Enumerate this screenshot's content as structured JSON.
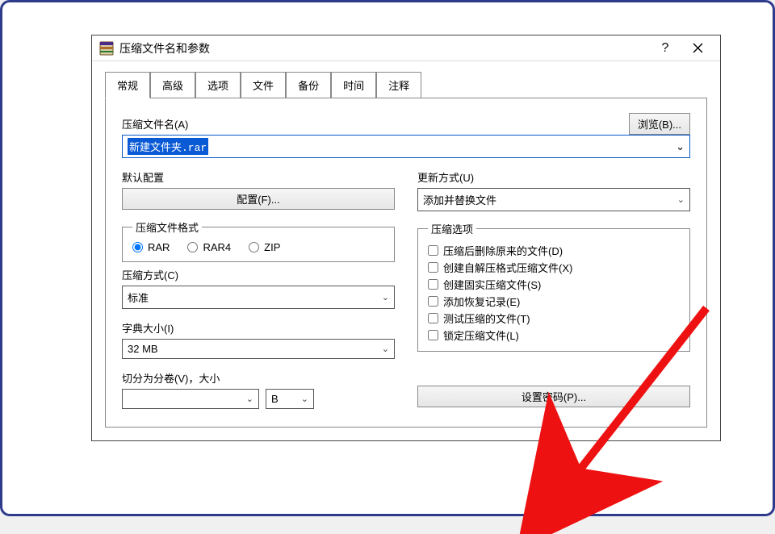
{
  "window": {
    "title": "压缩文件名和参数",
    "help": "?",
    "close": "X"
  },
  "tabs": {
    "items": [
      {
        "key": "general",
        "label": "常规"
      },
      {
        "key": "advanced",
        "label": "高级"
      },
      {
        "key": "options",
        "label": "选项"
      },
      {
        "key": "files",
        "label": "文件"
      },
      {
        "key": "backup",
        "label": "备份"
      },
      {
        "key": "time",
        "label": "时间"
      },
      {
        "key": "comment",
        "label": "注释"
      }
    ],
    "active": "general"
  },
  "general": {
    "archive_name_label": "压缩文件名(A)",
    "browse_label": "浏览(B)...",
    "archive_name_value": "新建文件夹.rar",
    "default_profile_label": "默认配置",
    "profiles_button": "配置(F)...",
    "update_mode_label": "更新方式(U)",
    "update_mode_value": "添加并替换文件",
    "format_group_label": "压缩文件格式",
    "formats": [
      {
        "key": "rar",
        "label": "RAR",
        "checked": true
      },
      {
        "key": "rar4",
        "label": "RAR4",
        "checked": false
      },
      {
        "key": "zip",
        "label": "ZIP",
        "checked": false
      }
    ],
    "method_label": "压缩方式(C)",
    "method_value": "标准",
    "dict_label": "字典大小(I)",
    "dict_value": "32 MB",
    "split_label": "切分为分卷(V)，大小",
    "split_value": "",
    "split_unit": "B",
    "options_group_label": "压缩选项",
    "options": [
      {
        "key": "delete_after",
        "label": "压缩后删除原来的文件(D)"
      },
      {
        "key": "sfx",
        "label": "创建自解压格式压缩文件(X)"
      },
      {
        "key": "solid",
        "label": "创建固实压缩文件(S)"
      },
      {
        "key": "recovery",
        "label": "添加恢复记录(E)"
      },
      {
        "key": "test",
        "label": "测试压缩的文件(T)"
      },
      {
        "key": "lock",
        "label": "锁定压缩文件(L)"
      }
    ],
    "set_password_label": "设置密码(P)..."
  }
}
